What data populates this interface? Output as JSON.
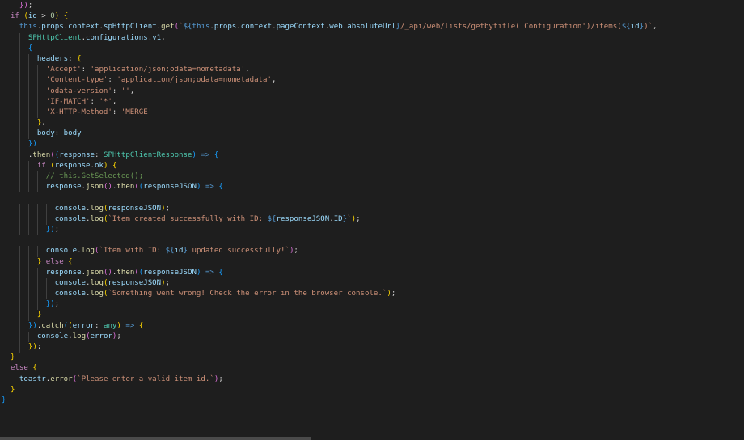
{
  "editor": {
    "language": "typescript",
    "lines": [
      [
        {
          "t": "    ",
          "c": "plain"
        },
        {
          "t": "})",
          "c": "bracket2"
        },
        {
          "t": ";",
          "c": "plain"
        }
      ],
      [
        {
          "t": "  ",
          "c": "plain"
        },
        {
          "t": "if",
          "c": "keyword"
        },
        {
          "t": " ",
          "c": "plain"
        },
        {
          "t": "(",
          "c": "bracket1"
        },
        {
          "t": "id",
          "c": "var"
        },
        {
          "t": " > ",
          "c": "plain"
        },
        {
          "t": "0",
          "c": "number"
        },
        {
          "t": ")",
          "c": "bracket1"
        },
        {
          "t": " ",
          "c": "plain"
        },
        {
          "t": "{",
          "c": "bracket1"
        }
      ],
      [
        {
          "t": "    ",
          "c": "plain"
        },
        {
          "t": "this",
          "c": "const"
        },
        {
          "t": ".",
          "c": "plain"
        },
        {
          "t": "props",
          "c": "var"
        },
        {
          "t": ".",
          "c": "plain"
        },
        {
          "t": "context",
          "c": "var"
        },
        {
          "t": ".",
          "c": "plain"
        },
        {
          "t": "spHttpClient",
          "c": "var"
        },
        {
          "t": ".",
          "c": "plain"
        },
        {
          "t": "get",
          "c": "func"
        },
        {
          "t": "(",
          "c": "bracket2"
        },
        {
          "t": "`",
          "c": "string"
        },
        {
          "t": "${",
          "c": "const"
        },
        {
          "t": "this",
          "c": "const"
        },
        {
          "t": ".",
          "c": "plain"
        },
        {
          "t": "props",
          "c": "var"
        },
        {
          "t": ".",
          "c": "plain"
        },
        {
          "t": "context",
          "c": "var"
        },
        {
          "t": ".",
          "c": "plain"
        },
        {
          "t": "pageContext",
          "c": "var"
        },
        {
          "t": ".",
          "c": "plain"
        },
        {
          "t": "web",
          "c": "var"
        },
        {
          "t": ".",
          "c": "plain"
        },
        {
          "t": "absoluteUrl",
          "c": "var"
        },
        {
          "t": "}",
          "c": "const"
        },
        {
          "t": "/_api/web/lists/getbytitle('Configuration')/items(",
          "c": "string"
        },
        {
          "t": "${",
          "c": "const"
        },
        {
          "t": "id",
          "c": "var"
        },
        {
          "t": "}",
          "c": "const"
        },
        {
          "t": ")`",
          "c": "string"
        },
        {
          "t": ",",
          "c": "plain"
        }
      ],
      [
        {
          "t": "      ",
          "c": "plain"
        },
        {
          "t": "SPHttpClient",
          "c": "type"
        },
        {
          "t": ".",
          "c": "plain"
        },
        {
          "t": "configurations",
          "c": "var"
        },
        {
          "t": ".",
          "c": "plain"
        },
        {
          "t": "v1",
          "c": "var"
        },
        {
          "t": ",",
          "c": "plain"
        }
      ],
      [
        {
          "t": "      ",
          "c": "plain"
        },
        {
          "t": "{",
          "c": "bracket3"
        }
      ],
      [
        {
          "t": "        ",
          "c": "plain"
        },
        {
          "t": "headers",
          "c": "var"
        },
        {
          "t": ": ",
          "c": "plain"
        },
        {
          "t": "{",
          "c": "bracket1"
        }
      ],
      [
        {
          "t": "          ",
          "c": "plain"
        },
        {
          "t": "'Accept'",
          "c": "string"
        },
        {
          "t": ": ",
          "c": "plain"
        },
        {
          "t": "'application/json;odata=nometadata'",
          "c": "string"
        },
        {
          "t": ",",
          "c": "plain"
        }
      ],
      [
        {
          "t": "          ",
          "c": "plain"
        },
        {
          "t": "'Content-type'",
          "c": "string"
        },
        {
          "t": ": ",
          "c": "plain"
        },
        {
          "t": "'application/json;odata=nometadata'",
          "c": "string"
        },
        {
          "t": ",",
          "c": "plain"
        }
      ],
      [
        {
          "t": "          ",
          "c": "plain"
        },
        {
          "t": "'odata-version'",
          "c": "string"
        },
        {
          "t": ": ",
          "c": "plain"
        },
        {
          "t": "''",
          "c": "string"
        },
        {
          "t": ",",
          "c": "plain"
        }
      ],
      [
        {
          "t": "          ",
          "c": "plain"
        },
        {
          "t": "'IF-MATCH'",
          "c": "string"
        },
        {
          "t": ": ",
          "c": "plain"
        },
        {
          "t": "'*'",
          "c": "string"
        },
        {
          "t": ",",
          "c": "plain"
        }
      ],
      [
        {
          "t": "          ",
          "c": "plain"
        },
        {
          "t": "'X-HTTP-Method'",
          "c": "string"
        },
        {
          "t": ": ",
          "c": "plain"
        },
        {
          "t": "'MERGE'",
          "c": "string"
        }
      ],
      [
        {
          "t": "        ",
          "c": "plain"
        },
        {
          "t": "}",
          "c": "bracket1"
        },
        {
          "t": ",",
          "c": "plain"
        }
      ],
      [
        {
          "t": "        ",
          "c": "plain"
        },
        {
          "t": "body",
          "c": "var"
        },
        {
          "t": ": ",
          "c": "plain"
        },
        {
          "t": "body",
          "c": "var"
        }
      ],
      [
        {
          "t": "      ",
          "c": "plain"
        },
        {
          "t": "})",
          "c": "bracket3"
        }
      ],
      [
        {
          "t": "      ",
          "c": "plain"
        },
        {
          "t": ".",
          "c": "plain"
        },
        {
          "t": "then",
          "c": "func"
        },
        {
          "t": "(",
          "c": "bracket2"
        },
        {
          "t": "(",
          "c": "bracket3"
        },
        {
          "t": "response",
          "c": "var"
        },
        {
          "t": ": ",
          "c": "plain"
        },
        {
          "t": "SPHttpClientResponse",
          "c": "type"
        },
        {
          "t": ")",
          "c": "bracket3"
        },
        {
          "t": " ",
          "c": "plain"
        },
        {
          "t": "=>",
          "c": "const"
        },
        {
          "t": " ",
          "c": "plain"
        },
        {
          "t": "{",
          "c": "bracket3"
        }
      ],
      [
        {
          "t": "        ",
          "c": "plain"
        },
        {
          "t": "if",
          "c": "keyword"
        },
        {
          "t": " ",
          "c": "plain"
        },
        {
          "t": "(",
          "c": "bracket1"
        },
        {
          "t": "response",
          "c": "var"
        },
        {
          "t": ".",
          "c": "plain"
        },
        {
          "t": "ok",
          "c": "var"
        },
        {
          "t": ")",
          "c": "bracket1"
        },
        {
          "t": " ",
          "c": "plain"
        },
        {
          "t": "{",
          "c": "bracket1"
        }
      ],
      [
        {
          "t": "          ",
          "c": "plain"
        },
        {
          "t": "// this.GetSelected();",
          "c": "comment"
        }
      ],
      [
        {
          "t": "          ",
          "c": "plain"
        },
        {
          "t": "response",
          "c": "var"
        },
        {
          "t": ".",
          "c": "plain"
        },
        {
          "t": "json",
          "c": "func"
        },
        {
          "t": "()",
          "c": "bracket2"
        },
        {
          "t": ".",
          "c": "plain"
        },
        {
          "t": "then",
          "c": "func"
        },
        {
          "t": "(",
          "c": "bracket2"
        },
        {
          "t": "(",
          "c": "bracket3"
        },
        {
          "t": "responseJSON",
          "c": "var"
        },
        {
          "t": ")",
          "c": "bracket3"
        },
        {
          "t": " ",
          "c": "plain"
        },
        {
          "t": "=>",
          "c": "const"
        },
        {
          "t": " ",
          "c": "plain"
        },
        {
          "t": "{",
          "c": "bracket3"
        }
      ],
      [
        {
          "t": "",
          "c": "plain"
        }
      ],
      [
        {
          "t": "            ",
          "c": "plain"
        },
        {
          "t": "console",
          "c": "var"
        },
        {
          "t": ".",
          "c": "plain"
        },
        {
          "t": "log",
          "c": "func"
        },
        {
          "t": "(",
          "c": "bracket1"
        },
        {
          "t": "responseJSON",
          "c": "var"
        },
        {
          "t": ")",
          "c": "bracket1"
        },
        {
          "t": ";",
          "c": "plain"
        }
      ],
      [
        {
          "t": "            ",
          "c": "plain"
        },
        {
          "t": "console",
          "c": "var"
        },
        {
          "t": ".",
          "c": "plain"
        },
        {
          "t": "log",
          "c": "func"
        },
        {
          "t": "(",
          "c": "bracket1"
        },
        {
          "t": "`Item created successfully with ID: ",
          "c": "string"
        },
        {
          "t": "${",
          "c": "const"
        },
        {
          "t": "responseJSON",
          "c": "var"
        },
        {
          "t": ".",
          "c": "plain"
        },
        {
          "t": "ID",
          "c": "var"
        },
        {
          "t": "}",
          "c": "const"
        },
        {
          "t": "`",
          "c": "string"
        },
        {
          "t": ")",
          "c": "bracket1"
        },
        {
          "t": ";",
          "c": "plain"
        }
      ],
      [
        {
          "t": "          ",
          "c": "plain"
        },
        {
          "t": "})",
          "c": "bracket3"
        },
        {
          "t": ";",
          "c": "plain"
        }
      ],
      [
        {
          "t": "",
          "c": "plain"
        }
      ],
      [
        {
          "t": "          ",
          "c": "plain"
        },
        {
          "t": "console",
          "c": "var"
        },
        {
          "t": ".",
          "c": "plain"
        },
        {
          "t": "log",
          "c": "func"
        },
        {
          "t": "(",
          "c": "bracket2"
        },
        {
          "t": "`Item with ID: ",
          "c": "string"
        },
        {
          "t": "${",
          "c": "const"
        },
        {
          "t": "id",
          "c": "var"
        },
        {
          "t": "}",
          "c": "const"
        },
        {
          "t": " updated successfully!`",
          "c": "string"
        },
        {
          "t": ")",
          "c": "bracket2"
        },
        {
          "t": ";",
          "c": "plain"
        }
      ],
      [
        {
          "t": "        ",
          "c": "plain"
        },
        {
          "t": "}",
          "c": "bracket1"
        },
        {
          "t": " ",
          "c": "plain"
        },
        {
          "t": "else",
          "c": "keyword"
        },
        {
          "t": " ",
          "c": "plain"
        },
        {
          "t": "{",
          "c": "bracket1"
        }
      ],
      [
        {
          "t": "          ",
          "c": "plain"
        },
        {
          "t": "response",
          "c": "var"
        },
        {
          "t": ".",
          "c": "plain"
        },
        {
          "t": "json",
          "c": "func"
        },
        {
          "t": "()",
          "c": "bracket2"
        },
        {
          "t": ".",
          "c": "plain"
        },
        {
          "t": "then",
          "c": "func"
        },
        {
          "t": "(",
          "c": "bracket2"
        },
        {
          "t": "(",
          "c": "bracket3"
        },
        {
          "t": "responseJSON",
          "c": "var"
        },
        {
          "t": ")",
          "c": "bracket3"
        },
        {
          "t": " ",
          "c": "plain"
        },
        {
          "t": "=>",
          "c": "const"
        },
        {
          "t": " ",
          "c": "plain"
        },
        {
          "t": "{",
          "c": "bracket3"
        }
      ],
      [
        {
          "t": "            ",
          "c": "plain"
        },
        {
          "t": "console",
          "c": "var"
        },
        {
          "t": ".",
          "c": "plain"
        },
        {
          "t": "log",
          "c": "func"
        },
        {
          "t": "(",
          "c": "bracket1"
        },
        {
          "t": "responseJSON",
          "c": "var"
        },
        {
          "t": ")",
          "c": "bracket1"
        },
        {
          "t": ";",
          "c": "plain"
        }
      ],
      [
        {
          "t": "            ",
          "c": "plain"
        },
        {
          "t": "console",
          "c": "var"
        },
        {
          "t": ".",
          "c": "plain"
        },
        {
          "t": "log",
          "c": "func"
        },
        {
          "t": "(",
          "c": "bracket1"
        },
        {
          "t": "`Something went wrong! Check the error in the browser console.`",
          "c": "string"
        },
        {
          "t": ")",
          "c": "bracket1"
        },
        {
          "t": ";",
          "c": "plain"
        }
      ],
      [
        {
          "t": "          ",
          "c": "plain"
        },
        {
          "t": "})",
          "c": "bracket3"
        },
        {
          "t": ";",
          "c": "plain"
        }
      ],
      [
        {
          "t": "        ",
          "c": "plain"
        },
        {
          "t": "}",
          "c": "bracket1"
        }
      ],
      [
        {
          "t": "      ",
          "c": "plain"
        },
        {
          "t": "})",
          "c": "bracket3"
        },
        {
          "t": ".",
          "c": "plain"
        },
        {
          "t": "catch",
          "c": "func"
        },
        {
          "t": "(",
          "c": "bracket3"
        },
        {
          "t": "(",
          "c": "bracket1"
        },
        {
          "t": "error",
          "c": "var"
        },
        {
          "t": ": ",
          "c": "plain"
        },
        {
          "t": "any",
          "c": "type"
        },
        {
          "t": ")",
          "c": "bracket1"
        },
        {
          "t": " ",
          "c": "plain"
        },
        {
          "t": "=>",
          "c": "const"
        },
        {
          "t": " ",
          "c": "plain"
        },
        {
          "t": "{",
          "c": "bracket1"
        }
      ],
      [
        {
          "t": "        ",
          "c": "plain"
        },
        {
          "t": "console",
          "c": "var"
        },
        {
          "t": ".",
          "c": "plain"
        },
        {
          "t": "log",
          "c": "func"
        },
        {
          "t": "(",
          "c": "bracket2"
        },
        {
          "t": "error",
          "c": "var"
        },
        {
          "t": ")",
          "c": "bracket2"
        },
        {
          "t": ";",
          "c": "plain"
        }
      ],
      [
        {
          "t": "      ",
          "c": "plain"
        },
        {
          "t": "})",
          "c": "bracket1"
        },
        {
          "t": ";",
          "c": "plain"
        }
      ],
      [
        {
          "t": "  ",
          "c": "plain"
        },
        {
          "t": "}",
          "c": "bracket1"
        }
      ],
      [
        {
          "t": "  ",
          "c": "plain"
        },
        {
          "t": "else",
          "c": "keyword"
        },
        {
          "t": " ",
          "c": "plain"
        },
        {
          "t": "{",
          "c": "bracket1"
        }
      ],
      [
        {
          "t": "    ",
          "c": "plain"
        },
        {
          "t": "toastr",
          "c": "var"
        },
        {
          "t": ".",
          "c": "plain"
        },
        {
          "t": "error",
          "c": "func"
        },
        {
          "t": "(",
          "c": "bracket2"
        },
        {
          "t": "`Please enter a valid item id.`",
          "c": "string"
        },
        {
          "t": ")",
          "c": "bracket2"
        },
        {
          "t": ";",
          "c": "plain"
        }
      ],
      [
        {
          "t": "  ",
          "c": "plain"
        },
        {
          "t": "}",
          "c": "bracket1"
        }
      ],
      [
        {
          "t": "}",
          "c": "bracket3"
        }
      ],
      [
        {
          "t": "",
          "c": "plain"
        }
      ],
      [
        {
          "t": "",
          "c": "plain"
        }
      ]
    ]
  }
}
